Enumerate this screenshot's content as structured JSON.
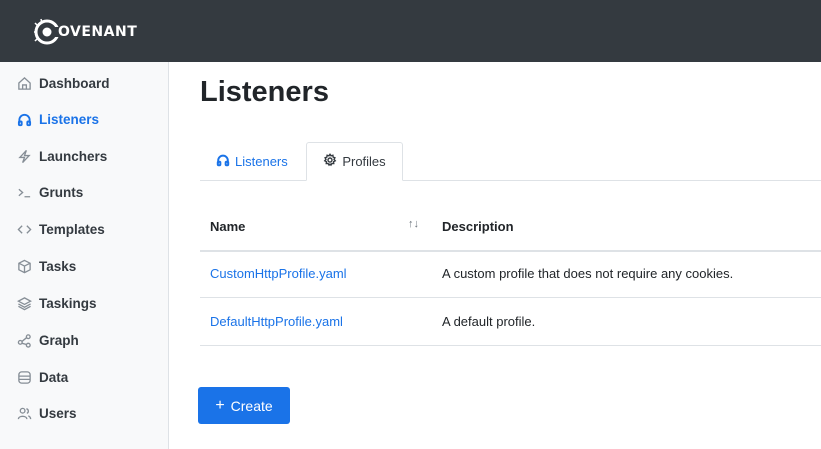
{
  "app": {
    "logo_text": "OVENANT"
  },
  "sidebar": {
    "items": [
      {
        "label": "Dashboard",
        "icon": "home-icon",
        "active": false
      },
      {
        "label": "Listeners",
        "icon": "headphones-icon",
        "active": true
      },
      {
        "label": "Launchers",
        "icon": "lightning-icon",
        "active": false
      },
      {
        "label": "Grunts",
        "icon": "terminal-icon",
        "active": false
      },
      {
        "label": "Templates",
        "icon": "code-icon",
        "active": false
      },
      {
        "label": "Tasks",
        "icon": "box-icon",
        "active": false
      },
      {
        "label": "Taskings",
        "icon": "layers-icon",
        "active": false
      },
      {
        "label": "Graph",
        "icon": "graph-icon",
        "active": false
      },
      {
        "label": "Data",
        "icon": "database-icon",
        "active": false
      },
      {
        "label": "Users",
        "icon": "users-icon",
        "active": false
      }
    ]
  },
  "main": {
    "title": "Listeners",
    "tabs": [
      {
        "label": "Listeners",
        "icon": "headphones-icon",
        "active": false
      },
      {
        "label": "Profiles",
        "icon": "gear-icon",
        "active": true
      }
    ],
    "table": {
      "columns": {
        "name": "Name",
        "sort_icon": "↑↓",
        "description": "Description"
      },
      "rows": [
        {
          "name": "CustomHttpProfile.yaml",
          "description": "A custom profile that does not require any cookies."
        },
        {
          "name": "DefaultHttpProfile.yaml",
          "description": "A default profile."
        }
      ]
    },
    "create_button": {
      "plus": "+",
      "label": "Create"
    }
  },
  "colors": {
    "topbar": "#343a40",
    "accent": "#1a73e8",
    "sidebar_bg": "#f8f9fa"
  }
}
